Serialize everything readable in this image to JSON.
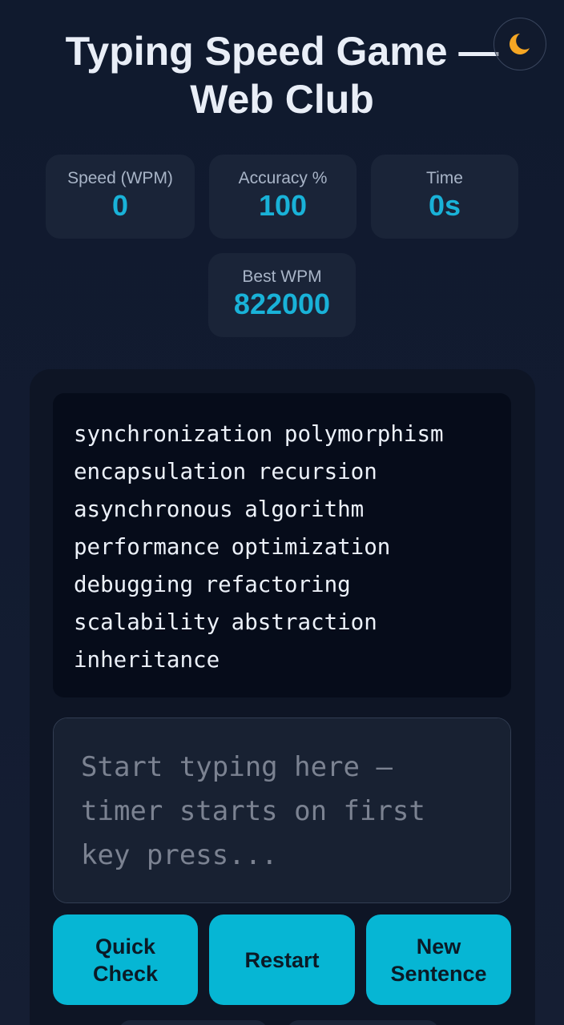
{
  "header": {
    "title": "Typing Speed Game — Web Club",
    "theme_toggle_icon": "moon-icon"
  },
  "stats": {
    "wpm": {
      "label": "Speed (WPM)",
      "value": "0"
    },
    "accuracy": {
      "label": "Accuracy %",
      "value": "100"
    },
    "time": {
      "label": "Time",
      "value": "0s"
    },
    "best": {
      "label": "Best WPM",
      "value": "822000"
    }
  },
  "game": {
    "sentence": "synchronization polymorphism encapsulation recursion asynchronous algorithm performance optimization debugging refactoring scalability abstraction inheritance",
    "input_value": "",
    "input_placeholder": "Start typing here — timer starts on first key press..."
  },
  "buttons": {
    "quick_check": "Quick Check",
    "restart": "Restart",
    "new_sentence": "New Sentence"
  },
  "colors": {
    "accent": "#06b6d4",
    "stat_value": "#19b2d8",
    "background": "#101a2e",
    "card": "#1a2438",
    "moon": "#f5a623"
  }
}
